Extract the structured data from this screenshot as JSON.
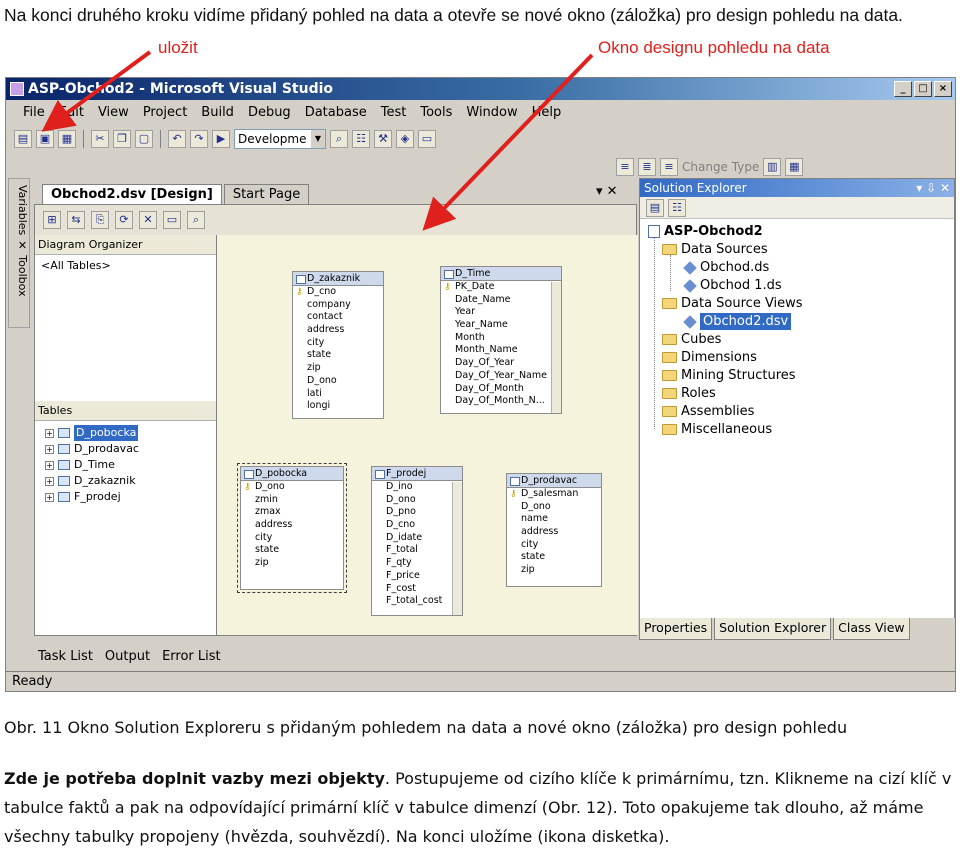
{
  "intro_text": "Na konci druhého kroku vidíme přidaný pohled na data a otevře se nové okno (záložka) pro design pohledu na data.",
  "callouts": {
    "save": "uložit",
    "design_window": "Okno designu pohledu na data"
  },
  "colors": {
    "arrow": "#e0201c",
    "titlebar": "#0a246a",
    "selection": "#316ac5"
  },
  "window": {
    "title": "ASP-Obchod2 - Microsoft Visual Studio",
    "controls": [
      "_",
      "□",
      "×"
    ]
  },
  "menu": [
    "File",
    "Edit",
    "View",
    "Project",
    "Build",
    "Debug",
    "Database",
    "Test",
    "Tools",
    "Window",
    "Help"
  ],
  "toolbar": {
    "config_combo": "Developme"
  },
  "toolbar2": {
    "change_type": "Change Type"
  },
  "side_strip": "Variables  ✕ Toolbox",
  "doc_tabs": [
    {
      "label": "Obchod2.dsv [Design]"
    },
    {
      "label": "Start Page"
    }
  ],
  "doc_controls": "▾ ✕",
  "left_pane": {
    "organizer_header": "Diagram Organizer",
    "organizer_item": "<All Tables>",
    "tables_header": "Tables",
    "tables": [
      "D_pobocka",
      "D_prodavac",
      "D_Time",
      "D_zakaznik",
      "F_prodej"
    ]
  },
  "diagram_tables": {
    "zakaznik": {
      "name": "D_zakaznik",
      "columns": [
        "D_cno",
        "company",
        "contact",
        "address",
        "city",
        "state",
        "zip",
        "D_ono",
        "lati",
        "longi"
      ]
    },
    "time": {
      "name": "D_Time",
      "columns": [
        "PK_Date",
        "Date_Name",
        "Year",
        "Year_Name",
        "Month",
        "Month_Name",
        "Day_Of_Year",
        "Day_Of_Year_Name",
        "Day_Of_Month",
        "Day_Of_Month_N..."
      ]
    },
    "pobocka": {
      "name": "D_pobocka",
      "columns": [
        "D_ono",
        "zmin",
        "zmax",
        "address",
        "city",
        "state",
        "zip"
      ]
    },
    "prodej": {
      "name": "F_prodej",
      "columns": [
        "D_ino",
        "D_ono",
        "D_pno",
        "D_cno",
        "D_idate",
        "F_total",
        "F_qty",
        "F_price",
        "F_cost",
        "F_total_cost"
      ]
    },
    "prodavac": {
      "name": "D_prodavac",
      "columns": [
        "D_salesman",
        "D_ono",
        "name",
        "address",
        "city",
        "state",
        "zip"
      ]
    }
  },
  "solution_explorer": {
    "title": "Solution Explorer",
    "controls": "▾ ⇩ ✕",
    "tree": {
      "root": "ASP-Obchod2",
      "data_sources": "Data Sources",
      "ds1": "Obchod.ds",
      "ds2": "Obchod 1.ds",
      "dsv": "Data Source Views",
      "dsv1": "Obchod2.dsv",
      "cubes": "Cubes",
      "dimensions": "Dimensions",
      "mining": "Mining Structures",
      "roles": "Roles",
      "assemblies": "Assemblies",
      "misc": "Miscellaneous"
    },
    "tabs": [
      "Properties",
      "Solution Explorer",
      "Class View"
    ]
  },
  "bottom_tabs": [
    "Task List",
    "Output",
    "Error List"
  ],
  "status": "Ready",
  "caption": "Obr. 11 Okno Solution Exploreru s přidaným pohledem na data a nové okno (záložka) pro design pohledu",
  "body": {
    "bold": "Zde je potřeba doplnit vazby mezi objekty",
    "rest": ". Postupujeme od cizího klíče k primárnímu, tzn. Klikneme na cizí klíč v tabulce faktů a pak na odpovídající primární klíč v tabulce dimenzí (Obr. 12). Toto opakujeme tak dlouho, až máme všechny tabulky propojeny (hvězda, souhvězdí). Na konci uložíme (ikona disketka)."
  }
}
